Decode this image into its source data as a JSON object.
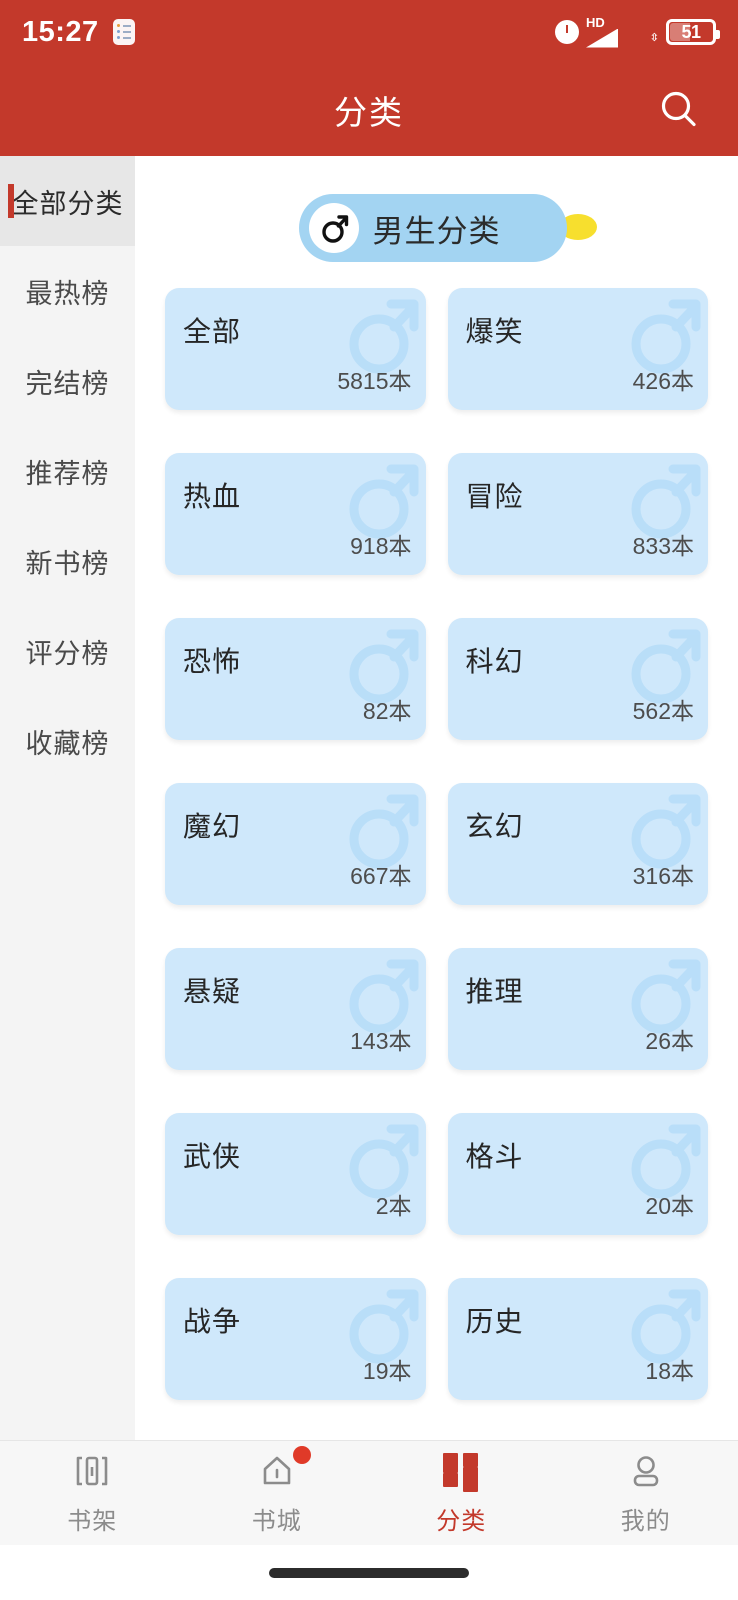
{
  "status_bar": {
    "time": "15:27",
    "notification_icon": "notes-icon",
    "clock_icon": "alarm-icon",
    "network_type": "HD",
    "signal_icon": "signal-bars-icon",
    "wifi_icon": "wifi-icon",
    "battery_level": "51",
    "battery_icon": "battery-icon"
  },
  "app_bar": {
    "title": "分类",
    "search_icon": "search-icon",
    "background_color": "#c3392b"
  },
  "sidebar": {
    "items": [
      {
        "label": "全部分类",
        "active": true
      },
      {
        "label": "最热榜",
        "active": false
      },
      {
        "label": "完结榜",
        "active": false
      },
      {
        "label": "推荐榜",
        "active": false
      },
      {
        "label": "新书榜",
        "active": false
      },
      {
        "label": "评分榜",
        "active": false
      },
      {
        "label": "收藏榜",
        "active": false
      }
    ],
    "active_indicator_color": "#c3392b"
  },
  "main": {
    "section_header": {
      "label": "男生分类",
      "icon": "male-gender-icon",
      "pill_color": "#a3d4f2",
      "accent_dot_color": "#f7df2e"
    },
    "card_color": "#cfe8fb",
    "count_unit": "本",
    "categories": [
      {
        "name": "全部",
        "count": "5815本"
      },
      {
        "name": "爆笑",
        "count": "426本"
      },
      {
        "name": "热血",
        "count": "918本"
      },
      {
        "name": "冒险",
        "count": "833本"
      },
      {
        "name": "恐怖",
        "count": "82本"
      },
      {
        "name": "科幻",
        "count": "562本"
      },
      {
        "name": "魔幻",
        "count": "667本"
      },
      {
        "name": "玄幻",
        "count": "316本"
      },
      {
        "name": "悬疑",
        "count": "143本"
      },
      {
        "name": "推理",
        "count": "26本"
      },
      {
        "name": "武侠",
        "count": "2本"
      },
      {
        "name": "格斗",
        "count": "20本"
      },
      {
        "name": "战争",
        "count": "19本"
      },
      {
        "name": "历史",
        "count": "18本"
      }
    ]
  },
  "bottom_nav": {
    "active_color": "#c3392b",
    "inactive_color": "#8c8c8c",
    "items": [
      {
        "label": "书架",
        "icon": "bookshelf-icon",
        "active": false,
        "badge": false
      },
      {
        "label": "书城",
        "icon": "home-icon",
        "active": false,
        "badge": true
      },
      {
        "label": "分类",
        "icon": "grid-icon",
        "active": true,
        "badge": false
      },
      {
        "label": "我的",
        "icon": "person-icon",
        "active": false,
        "badge": false
      }
    ]
  }
}
